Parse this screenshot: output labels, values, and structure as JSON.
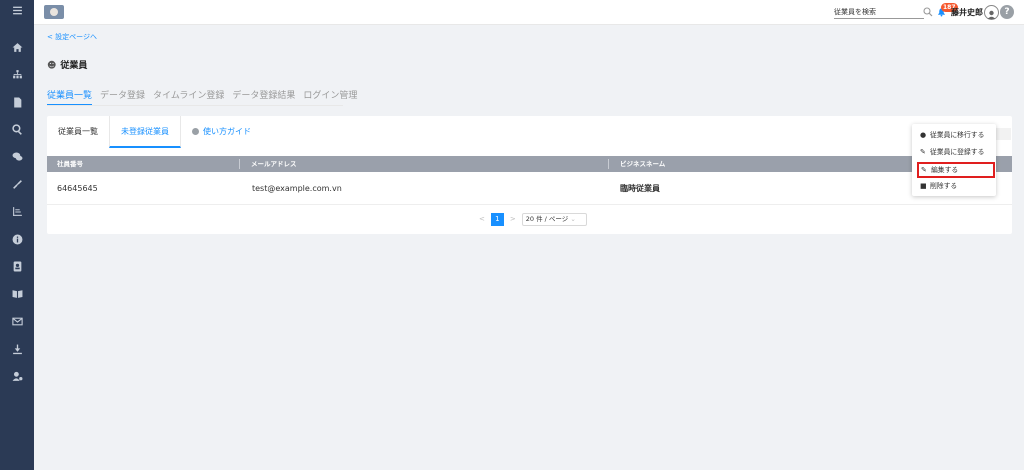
{
  "sidebar": {
    "items": [
      {
        "icon": "menu-icon"
      },
      {
        "icon": "home-icon"
      },
      {
        "icon": "org-chart-icon"
      },
      {
        "icon": "document-icon"
      },
      {
        "icon": "search-icon"
      },
      {
        "icon": "chat-icon"
      },
      {
        "icon": "link-icon"
      },
      {
        "icon": "chart-icon"
      },
      {
        "icon": "info-icon"
      },
      {
        "icon": "contact-icon"
      },
      {
        "icon": "book-icon"
      },
      {
        "icon": "mail-icon"
      },
      {
        "icon": "download-icon"
      },
      {
        "icon": "user-settings-icon"
      }
    ]
  },
  "header": {
    "search_placeholder": "従業員を検索",
    "notification_count": "187",
    "user_name": "藤井史郎",
    "help_label": "?"
  },
  "breadcrumb": "< 設定ページへ",
  "page_title": "従業員",
  "tabs": [
    {
      "label": "従業員一覧",
      "active": true
    },
    {
      "label": "データ登録",
      "active": false
    },
    {
      "label": "タイムライン登録",
      "active": false
    },
    {
      "label": "データ登録結果",
      "active": false
    },
    {
      "label": "ログイン管理",
      "active": false
    }
  ],
  "subtabs": [
    {
      "label": "従業員一覧"
    },
    {
      "label": "未登録従業員"
    },
    {
      "label": "使い方ガイド"
    }
  ],
  "table": {
    "columns": [
      "社員番号",
      "メールアドレス",
      "ビジネスネーム"
    ],
    "rows": [
      [
        "64645645",
        "test@example.com.vn",
        "臨時従業員"
      ]
    ]
  },
  "pagination": {
    "prev": "<",
    "current_page": "1",
    "next": ">",
    "page_size": "20 件 / ページ"
  },
  "context_menu": {
    "items": [
      {
        "icon": "transfer-icon",
        "label": "従業員に移行する"
      },
      {
        "icon": "pencil-icon",
        "label": "従業員に登録する"
      },
      {
        "icon": "edit-icon",
        "label": "編集する",
        "highlighted": true
      },
      {
        "icon": "trash-icon",
        "label": "削除する"
      }
    ]
  },
  "colors": {
    "sidebar": "#2b3a55",
    "accent": "#1890ff",
    "highlight_border": "#e01e1e",
    "table_header": "#9aa0ab"
  }
}
